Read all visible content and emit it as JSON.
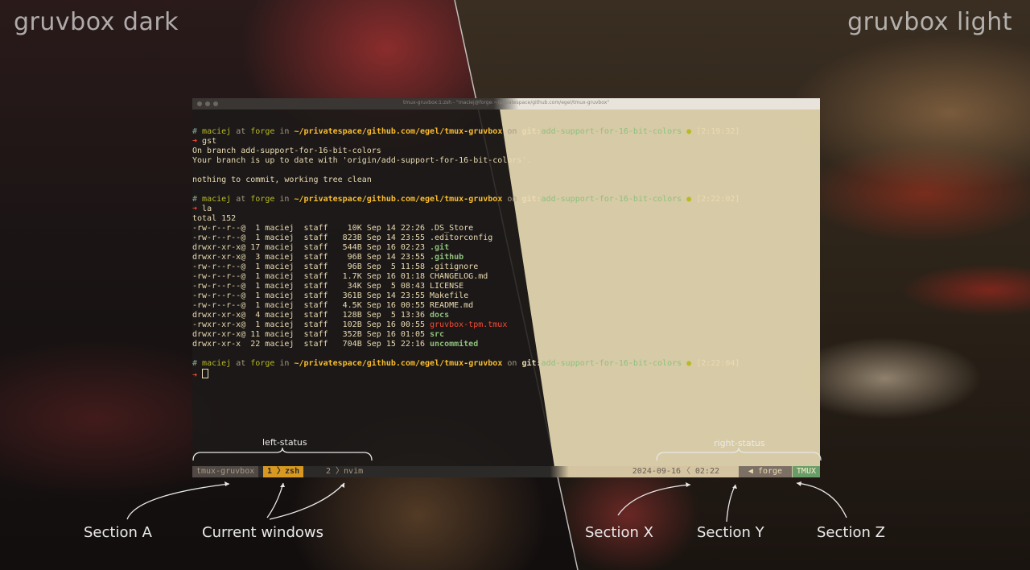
{
  "themes": {
    "dark_label": "gruvbox dark",
    "light_label": "gruvbox light"
  },
  "window": {
    "title": "tmux-gruvbox:1:zsh - \"maciej@forge:~/privatespace/github.com/egel/tmux-gruvbox\""
  },
  "prompt": {
    "hash": "#",
    "user": "maciej",
    "at": "at",
    "host": "forge",
    "in": "in",
    "path": "~/privatespace/github.com/egel/tmux-gruvbox",
    "on": "on",
    "git": "git:",
    "branch": "add-support-for-16-bit-colors",
    "status_dot": "●",
    "arrow": "➜"
  },
  "session1": {
    "time": "[2:19:32]",
    "command": "gst",
    "output": [
      "On branch add-support-for-16-bit-colors",
      "Your branch is up to date with 'origin/add-support-for-16-bit-colors'.",
      "",
      "nothing to commit, working tree clean"
    ]
  },
  "session2": {
    "time": "[2:22:02]",
    "command": "la",
    "total": "total 152",
    "listing": [
      {
        "perm": "-rw-r--r--@",
        "links": " 1",
        "owner": "maciej",
        "group": "staff",
        "size": "  10K",
        "date": "Sep 14 22:26",
        "name": ".DS_Store",
        "kind": "file"
      },
      {
        "perm": "-rw-r--r--@",
        "links": " 1",
        "owner": "maciej",
        "group": "staff",
        "size": " 823B",
        "date": "Sep 14 23:55",
        "name": ".editorconfig",
        "kind": "file"
      },
      {
        "perm": "drwxr-xr-x@",
        "links": "17",
        "owner": "maciej",
        "group": "staff",
        "size": " 544B",
        "date": "Sep 16 02:23",
        "name": ".git",
        "kind": "dir"
      },
      {
        "perm": "drwxr-xr-x@",
        "links": " 3",
        "owner": "maciej",
        "group": "staff",
        "size": "  96B",
        "date": "Sep 14 23:55",
        "name": ".github",
        "kind": "dir"
      },
      {
        "perm": "-rw-r--r--@",
        "links": " 1",
        "owner": "maciej",
        "group": "staff",
        "size": "  96B",
        "date": "Sep  5 11:58",
        "name": ".gitignore",
        "kind": "file"
      },
      {
        "perm": "-rw-r--r--@",
        "links": " 1",
        "owner": "maciej",
        "group": "staff",
        "size": " 1.7K",
        "date": "Sep 16 01:18",
        "name": "CHANGELOG.md",
        "kind": "file"
      },
      {
        "perm": "-rw-r--r--@",
        "links": " 1",
        "owner": "maciej",
        "group": "staff",
        "size": "  34K",
        "date": "Sep  5 08:43",
        "name": "LICENSE",
        "kind": "file"
      },
      {
        "perm": "-rw-r--r--@",
        "links": " 1",
        "owner": "maciej",
        "group": "staff",
        "size": " 361B",
        "date": "Sep 14 23:55",
        "name": "Makefile",
        "kind": "file"
      },
      {
        "perm": "-rw-r--r--@",
        "links": " 1",
        "owner": "maciej",
        "group": "staff",
        "size": " 4.5K",
        "date": "Sep 16 00:55",
        "name": "README.md",
        "kind": "file"
      },
      {
        "perm": "drwxr-xr-x@",
        "links": " 4",
        "owner": "maciej",
        "group": "staff",
        "size": " 128B",
        "date": "Sep  5 13:36",
        "name": "docs",
        "kind": "dir"
      },
      {
        "perm": "-rwxr-xr-x@",
        "links": " 1",
        "owner": "maciej",
        "group": "staff",
        "size": " 102B",
        "date": "Sep 16 00:55",
        "name": "gruvbox-tpm.tmux",
        "kind": "exe"
      },
      {
        "perm": "drwxr-xr-x@",
        "links": "11",
        "owner": "maciej",
        "group": "staff",
        "size": " 352B",
        "date": "Sep 16 01:05",
        "name": "src",
        "kind": "dir"
      },
      {
        "perm": "drwxr-xr-x ",
        "links": "22",
        "owner": "maciej",
        "group": "staff",
        "size": " 704B",
        "date": "Sep 15 22:16",
        "name": "uncommited",
        "kind": "dir"
      }
    ]
  },
  "session3": {
    "time": "[2:22:04]"
  },
  "statusbar": {
    "session": "tmux-gruvbox",
    "window1": "1 〉zsh",
    "window2": "2 〉nvim",
    "date": "2024-09-16",
    "time_sep": "〈",
    "time": "02:22",
    "host_sep": "◀",
    "host": "forge",
    "tmux": "TMUX"
  },
  "annotations": {
    "left_status": "left-status",
    "right_status": "right-status",
    "section_a": "Section A",
    "current_windows": "Current windows",
    "section_x": "Section X",
    "section_y": "Section Y",
    "section_z": "Section Z"
  }
}
